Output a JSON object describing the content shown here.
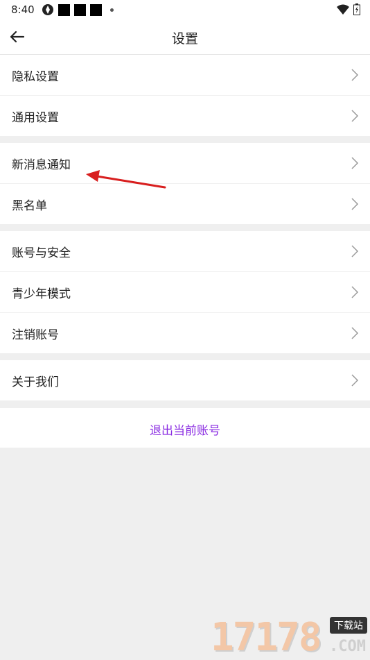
{
  "status_bar": {
    "time": "8:40"
  },
  "header": {
    "title": "设置",
    "back_icon": "arrow-left-icon"
  },
  "groups": [
    {
      "items": [
        {
          "label": "隐私设置"
        },
        {
          "label": "通用设置"
        }
      ]
    },
    {
      "items": [
        {
          "label": "新消息通知"
        },
        {
          "label": "黑名单"
        }
      ]
    },
    {
      "items": [
        {
          "label": "账号与安全"
        },
        {
          "label": "青少年模式"
        },
        {
          "label": "注销账号"
        }
      ]
    },
    {
      "items": [
        {
          "label": "关于我们"
        }
      ]
    }
  ],
  "logout": {
    "label": "退出当前账号",
    "color": "#8a2be2"
  },
  "annotation_color": "#d81e1e",
  "watermark": {
    "number": "17178",
    "tag": "下载站",
    "suffix": ".COM"
  }
}
